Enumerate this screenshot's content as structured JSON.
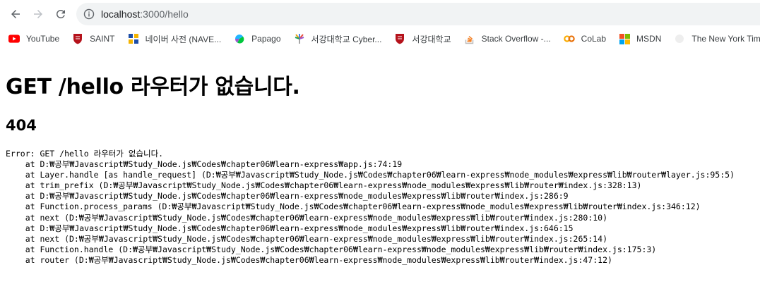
{
  "browser": {
    "url_host": "localhost",
    "url_rest": ":3000/hello"
  },
  "bookmarks": [
    {
      "label": "YouTube",
      "icon": "youtube-icon",
      "color": "#ff0000"
    },
    {
      "label": "SAINT",
      "icon": "sogang-shield-icon",
      "color": "#b5121b"
    },
    {
      "label": "네이버 사전 (NAVE...",
      "icon": "naver-dictionary-icon",
      "color": "#1d4ea8"
    },
    {
      "label": "Papago",
      "icon": "papago-icon",
      "color": "#1fb6ff"
    },
    {
      "label": "서강대학교 Cyber...",
      "icon": "cyber-campus-icon",
      "color": "#e8a317"
    },
    {
      "label": "서강대학교",
      "icon": "sogang-shield-icon",
      "color": "#b5121b"
    },
    {
      "label": "Stack Overflow -...",
      "icon": "stackoverflow-icon",
      "color": "#f48024"
    },
    {
      "label": "CoLab",
      "icon": "colab-icon",
      "color": "#f9ab00"
    },
    {
      "label": "MSDN",
      "icon": "microsoft-icon",
      "color": "#f25022"
    },
    {
      "label": "The New York Tim...",
      "icon": "nyt-icon",
      "color": "#dddddd"
    }
  ],
  "page": {
    "title": "GET /hello 라우터가 없습니다.",
    "status": "404",
    "stack": [
      "Error: GET /hello 라우터가 없습니다.",
      "    at D:₩공부₩Javascript₩Study_Node.js₩Codes₩chapter06₩learn-express₩app.js:74:19",
      "    at Layer.handle [as handle_request] (D:₩공부₩Javascript₩Study_Node.js₩Codes₩chapter06₩learn-express₩node_modules₩express₩lib₩router₩layer.js:95:5)",
      "    at trim_prefix (D:₩공부₩Javascript₩Study_Node.js₩Codes₩chapter06₩learn-express₩node_modules₩express₩lib₩router₩index.js:328:13)",
      "    at D:₩공부₩Javascript₩Study_Node.js₩Codes₩chapter06₩learn-express₩node_modules₩express₩lib₩router₩index.js:286:9",
      "    at Function.process_params (D:₩공부₩Javascript₩Study_Node.js₩Codes₩chapter06₩learn-express₩node_modules₩express₩lib₩router₩index.js:346:12)",
      "    at next (D:₩공부₩Javascript₩Study_Node.js₩Codes₩chapter06₩learn-express₩node_modules₩express₩lib₩router₩index.js:280:10)",
      "    at D:₩공부₩Javascript₩Study_Node.js₩Codes₩chapter06₩learn-express₩node_modules₩express₩lib₩router₩index.js:646:15",
      "    at next (D:₩공부₩Javascript₩Study_Node.js₩Codes₩chapter06₩learn-express₩node_modules₩express₩lib₩router₩index.js:265:14)",
      "    at Function.handle (D:₩공부₩Javascript₩Study_Node.js₩Codes₩chapter06₩learn-express₩node_modules₩express₩lib₩router₩index.js:175:3)",
      "    at router (D:₩공부₩Javascript₩Study_Node.js₩Codes₩chapter06₩learn-express₩node_modules₩express₩lib₩router₩index.js:47:12)"
    ]
  }
}
